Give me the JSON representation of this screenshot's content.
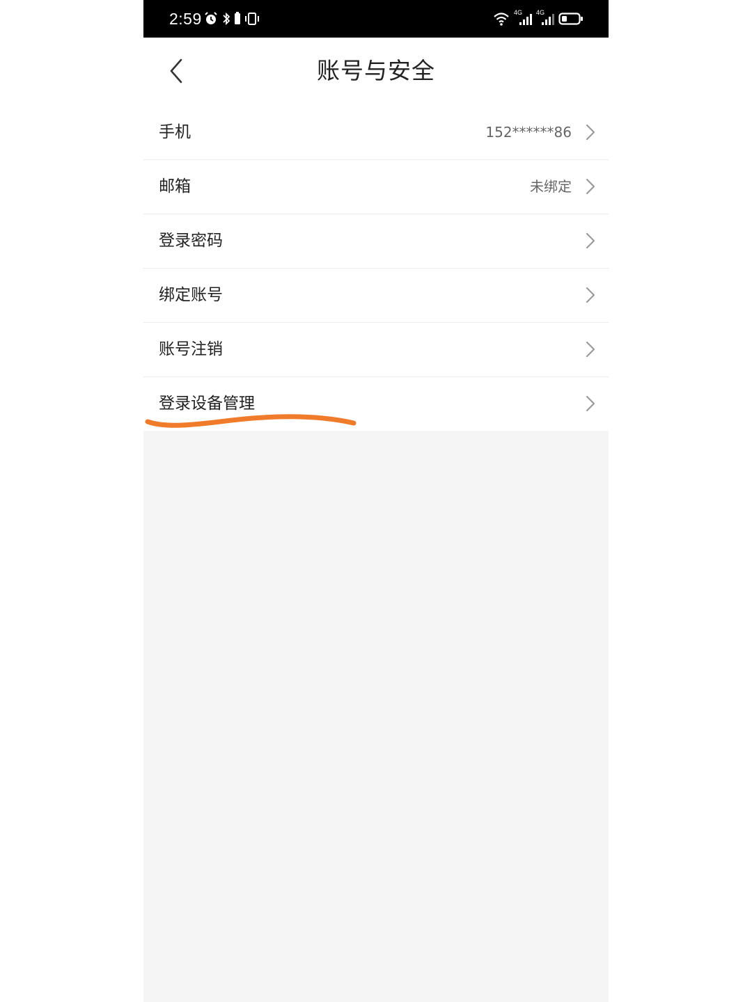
{
  "status_bar": {
    "time": "2:59",
    "network_label_1": "4G",
    "network_label_2": "4G",
    "left_icons": [
      "alarm-icon",
      "bluetooth-icon",
      "vibrate-icon"
    ],
    "right_icons": [
      "wifi-icon",
      "signal-icon",
      "signal-icon",
      "battery-icon"
    ]
  },
  "header": {
    "title": "账号与安全",
    "back_icon": "chevron-left-icon"
  },
  "menu": {
    "items": [
      {
        "label": "手机",
        "value": "152******86"
      },
      {
        "label": "邮箱",
        "value": "未绑定"
      },
      {
        "label": "登录密码",
        "value": ""
      },
      {
        "label": "绑定账号",
        "value": ""
      },
      {
        "label": "账号注销",
        "value": ""
      },
      {
        "label": "登录设备管理",
        "value": ""
      }
    ],
    "chevron_icon": "chevron-right-icon"
  },
  "colors": {
    "background": "#f5f5f5",
    "status_bar": "#000000",
    "text_primary": "#222222",
    "text_secondary": "#666666",
    "chevron": "#9a9a9a",
    "divider": "#ececec",
    "highlight_annotation": "#f07b2a"
  }
}
